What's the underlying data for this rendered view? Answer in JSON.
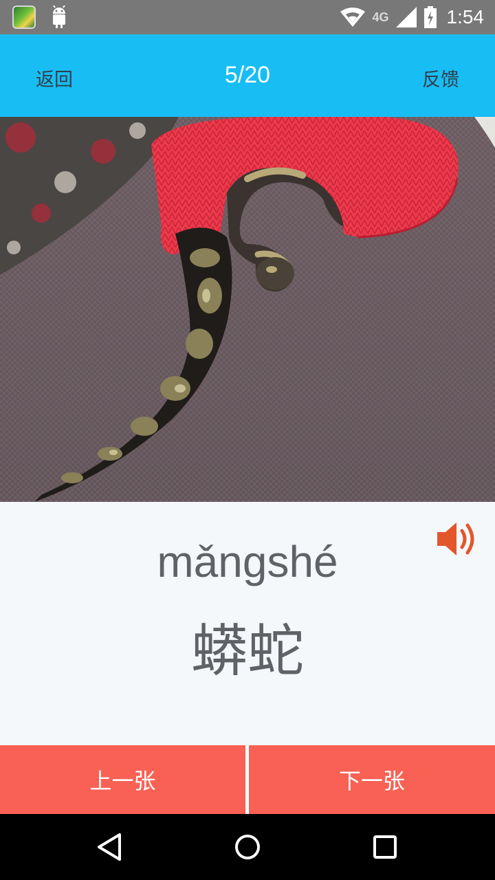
{
  "status_bar": {
    "network_label": "4G",
    "time": "1:54",
    "icons": [
      "app-icon",
      "android-icon",
      "wifi-icon",
      "signal-icon",
      "battery-icon"
    ]
  },
  "top_bar": {
    "back_label": "返回",
    "counter": "5/20",
    "feedback_label": "反馈"
  },
  "card": {
    "pinyin": "mǎngshé",
    "hanzi": "蟒蛇",
    "speaker_icon": "speaker-icon",
    "accent_color": "#e2562a"
  },
  "buttons": {
    "prev_label": "上一张",
    "next_label": "下一张",
    "color": "#f96154"
  },
  "nav_bar": {
    "icons": [
      "back-triangle-icon",
      "home-circle-icon",
      "recents-square-icon"
    ]
  },
  "colors": {
    "header": "#18bdf4",
    "status_bar": "#787878",
    "card_background": "#f4f8fb"
  }
}
